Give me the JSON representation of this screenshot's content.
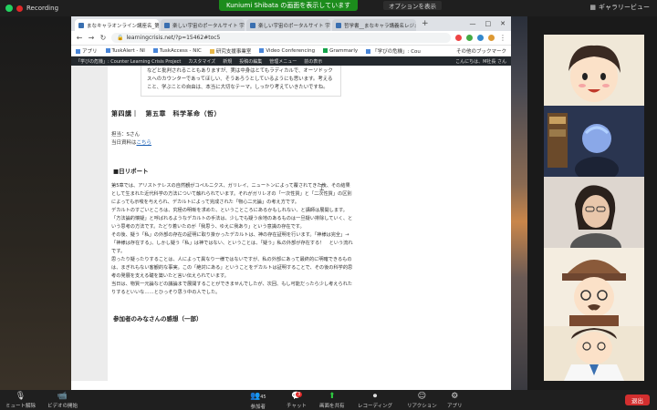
{
  "zoom": {
    "recording_label": "Recording",
    "share_banner": "Kuniumi Shibata の画面を表示しています",
    "options_label": "オプションを表示",
    "gallery_label": "ギャラリービュー",
    "toolbar": {
      "mute": "ミュート解除",
      "video": "ビデオの開始",
      "participants": "参加者",
      "participants_count": "45",
      "chat": "チャット",
      "chat_badge": "3",
      "share": "画面を共有",
      "record": "レコーディング",
      "reactions": "リアクション",
      "apps": "アプリ",
      "end": "退出"
    }
  },
  "browser": {
    "tabs": [
      {
        "label": "まなキャラオンライン講座名_第三ガ"
      },
      {
        "label": "楽しい宇宙のポータルサイト 宇宙"
      },
      {
        "label": "楽しい宇宙のポータルサイト 宇宙"
      },
      {
        "label": "哲学書__まなキャラ講義名レジュメ"
      }
    ],
    "url": "learningcrisis.net/?p=15462#toc5",
    "bookmarks": [
      "アプリ",
      "TuskAlert - NI",
      "TuskAccess - NIC",
      "研究支援事業室",
      "Video Conferencing",
      "Grammarly",
      "「学びの危機」: Cou"
    ],
    "bookmarks_right": "その他のブックマーク",
    "wp_bar": [
      "「学びの危機」: Counter Learning Crisis Project",
      "カスタマイズ",
      "新規",
      "投稿の編集",
      "管理メニュー",
      "前の表示"
    ],
    "wp_bar_right": "こんにちは、M社長 さん"
  },
  "article": {
    "quote": "などと批判されることもありますが、実は中身はとてもラディカルで、オーソドックスへのカウンターであってほしい、そうあろうとしているようにも思います。考えること、学ぶことの自由は、本当に大切なテーマ。しっかり考えていきたいですね。",
    "section_title": "第四講｜　第五章　科学革命（哲）",
    "presenter": "担当：Sさん",
    "materials_prefix": "当日資料は",
    "materials_link": "こちら",
    "report_heading": "■日リポート",
    "paragraphs": [
      "第5章では、アリストテレスの自然観がコペルニクス、ガリレイ、ニュートンによって覆されてきた後、その結果として生まれた近代科学の方法について触れられています。それがガリレオの「一次性質」と「二次性質」の区別によっても示唆を与えられ、デカルトによって完成された「物心二元論」の考え方です。",
      "デカルトのすごいところは、究極の明晰を求めた、ということころにあるかもしれない、と講師は展開します。「方法論的懐疑」と呼ばれるようなデカルトの手法は、少しでも疑う余地のあるものは一旦疑い排除していく、という思考の方法です。たどり着いたのが「我思う、ゆえに我あり」という意識の存在です。",
      "その後、疑う「私」の外部の存在の証明に取り掛かったデカルトは、神の存在証明を行います。「神様は完全」→「神様は存在する」、しかし疑う「私」は神ではない、ということは、「疑う」私の外部が存在する！　という流れです。",
      "思ったり疑ったりすることは、人によって異なり一様ではないですが、私の外部にあって最終的に明確できるものは、まぎれもない客観的な事実。この「絶対にある」ということをデカルトは証明することで、その後の科学的思考の発展を支える礎を築いたと言い伝えられています。",
      "当日は、物質一元論などの議論まで展開することができませんでしたが、次回、もし可能だったら少し考えられたりするといいな……とひっそり思う中の人でした。"
    ],
    "impressions_heading": "参加者のみなさんの感想（一部）"
  },
  "colors": {
    "zoom_green": "#23d160",
    "record_red": "#e02828",
    "link_blue": "#1a5fb4",
    "end_red": "#d32f2f"
  }
}
